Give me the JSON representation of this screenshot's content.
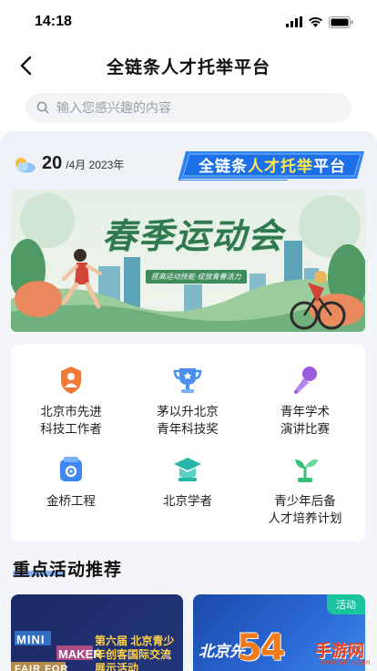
{
  "status_bar": {
    "time": "14:18"
  },
  "nav": {
    "title": "全链条人才托举平台"
  },
  "search": {
    "placeholder": "输入您感兴趣的内容"
  },
  "date": {
    "day": "20",
    "rest": "/4月 2023年"
  },
  "platform_badge": {
    "part1": "全链条",
    "part2": "人才托举",
    "part3": "平台"
  },
  "banner": {
    "title": "春季运动会",
    "subtitle": "提高运动技能·绽放青春活力"
  },
  "grid": [
    {
      "label": "北京市先进\n科技工作者",
      "icon": "badge-people-icon",
      "color": "#ef7a3a"
    },
    {
      "label": "茅以升北京\n青年科技奖",
      "icon": "trophy-icon",
      "color": "#4a8ff0"
    },
    {
      "label": "青年学术\n演讲比赛",
      "icon": "microphone-icon",
      "color": "#9b5be0"
    },
    {
      "label": "金桥工程",
      "icon": "gear-box-icon",
      "color": "#3f88f2"
    },
    {
      "label": "北京学者",
      "icon": "graduation-cap-icon",
      "color": "#27b7a7"
    },
    {
      "label": "青少年后备\n人才培养计划",
      "icon": "sprout-icon",
      "color": "#35c075"
    }
  ],
  "section": {
    "title": "重点活动推荐"
  },
  "cards": [
    {
      "mini": "MINI",
      "maker": "MAKER",
      "fair": "FAIR FOR",
      "title": "第六届 北京青少年创客国际交流展示活动"
    },
    {
      "tag": "活动",
      "text": "北京先"
    }
  ],
  "watermark": {
    "num": "54",
    "text": "手游网",
    "url": "www.54hb.com"
  }
}
